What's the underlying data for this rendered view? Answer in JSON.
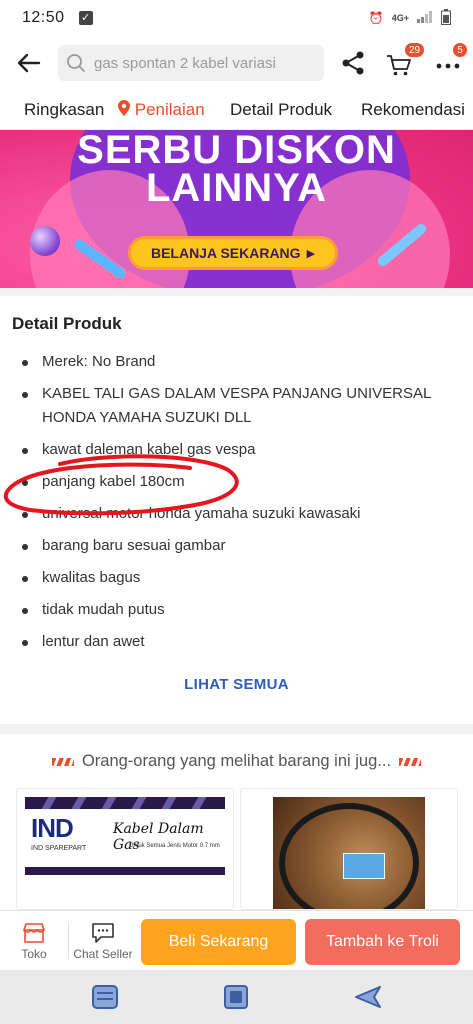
{
  "status_bar": {
    "time": "12:50",
    "network": "4G+"
  },
  "top_bar": {
    "search_placeholder": "gas spontan 2 kabel variasi",
    "cart_badge": "29",
    "more_badge": "5"
  },
  "tabs": [
    {
      "label": "Ringkasan"
    },
    {
      "label": "Penilaian"
    },
    {
      "label": "Detail Produk"
    },
    {
      "label": "Rekomendasi"
    }
  ],
  "banner": {
    "line1": "SERBU DISKON",
    "line2": "LAINNYA",
    "button": "BELANJA SEKARANG"
  },
  "detail": {
    "title": "Detail Produk",
    "items": [
      "Merek: No Brand",
      "KABEL TALI GAS DALAM VESPA PANJANG UNIVERSAL HONDA YAMAHA SUZUKI DLL",
      "kawat daleman kabel gas vespa",
      "panjang kabel 180cm",
      "universal motor honda yamaha suzuki kawasaki",
      "barang baru sesuai gambar",
      "kwalitas bagus",
      "tidak mudah putus",
      "lentur dan awet"
    ],
    "see_all": "LIHAT SEMUA"
  },
  "recommendation": {
    "heading": "Orang-orang yang melihat barang ini jug...",
    "product1": {
      "logo": "IND",
      "logo_sub": "IND SPAREPART",
      "title": "Kabel Dalam Gas",
      "subtitle": "Untuk Semua Jenis Motor 0.7 mm"
    }
  },
  "actions": {
    "shop": "Toko",
    "chat": "Chat Seller",
    "buy": "Beli Sekarang",
    "add_cart": "Tambah ke Troli"
  },
  "colors": {
    "accent": "#ee4d2d",
    "buy": "#ffa41c",
    "add_cart": "#f36c5d",
    "link": "#2d5fb8"
  }
}
